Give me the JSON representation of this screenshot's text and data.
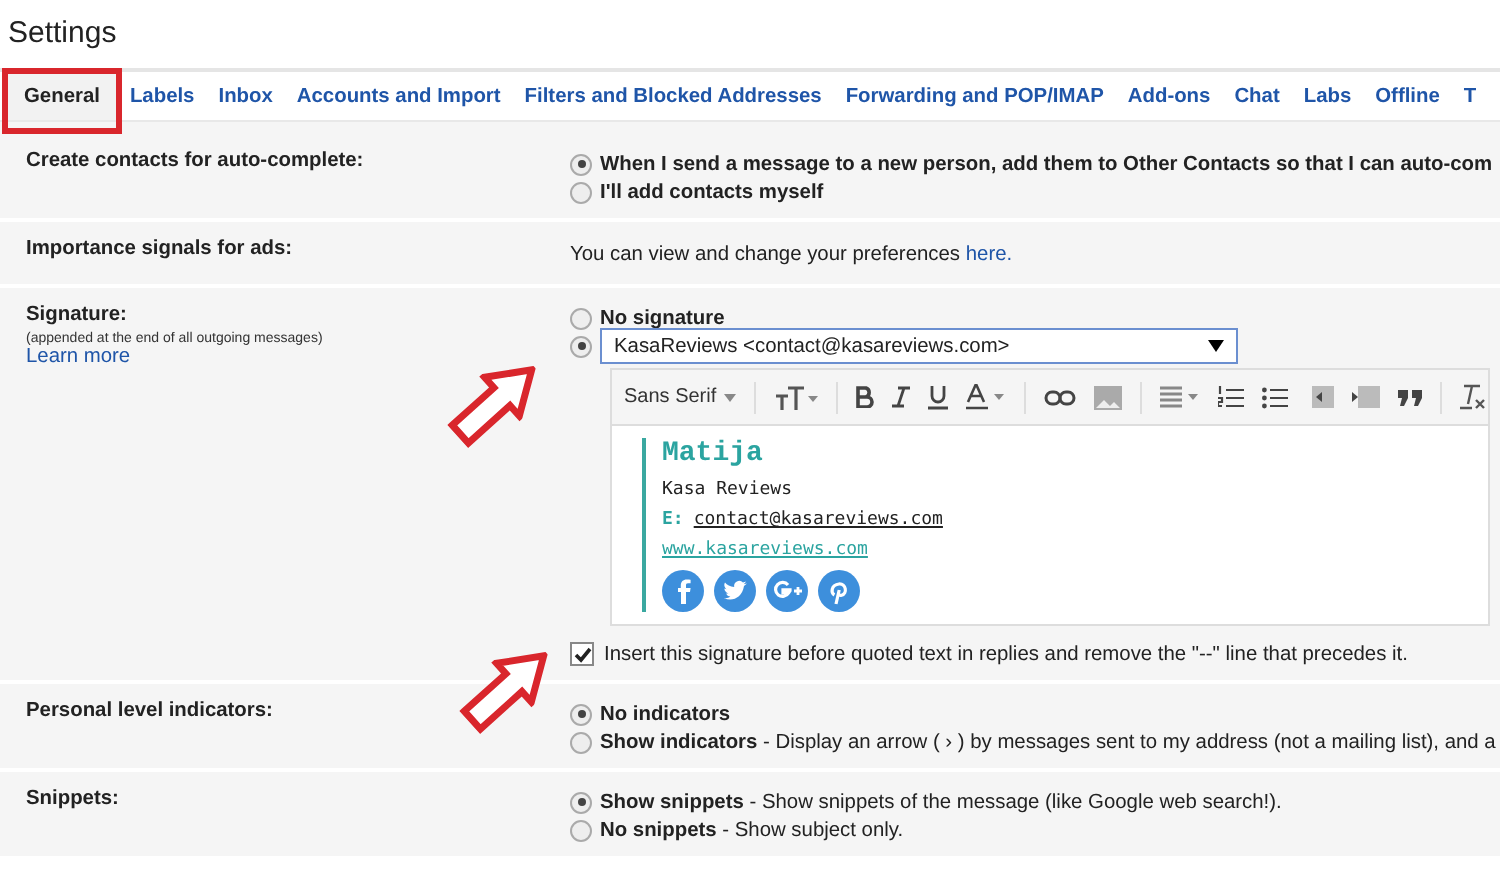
{
  "page_title": "Settings",
  "tabs": [
    {
      "label": "General",
      "selected": true
    },
    {
      "label": "Labels",
      "selected": false
    },
    {
      "label": "Inbox",
      "selected": false
    },
    {
      "label": "Accounts and Import",
      "selected": false
    },
    {
      "label": "Filters and Blocked Addresses",
      "selected": false
    },
    {
      "label": "Forwarding and POP/IMAP",
      "selected": false
    },
    {
      "label": "Add-ons",
      "selected": false
    },
    {
      "label": "Chat",
      "selected": false
    },
    {
      "label": "Labs",
      "selected": false
    },
    {
      "label": "Offline",
      "selected": false
    },
    {
      "label": "T",
      "selected": false
    }
  ],
  "settings": [
    {
      "kind": "radio",
      "label": "Create contacts for auto-complete:",
      "options": [
        {
          "text": "When I send a message to a new person, add them to Other Contacts so that I can auto-com",
          "bold": true,
          "selected": true
        },
        {
          "text": "I'll add contacts myself",
          "bold": true,
          "selected": false
        }
      ]
    },
    {
      "kind": "info",
      "label": "Importance signals for ads:",
      "text": "You can view and change your preferences",
      "link": "here."
    },
    {
      "kind": "signature",
      "label": "Signature:",
      "note": "(appended at the end of all outgoing messages)",
      "link": "Learn more",
      "none_option": {
        "text": "No signature",
        "selected": false
      },
      "custom_option": {
        "selected": true,
        "value": "KasaReviews <contact@kasareviews.com>"
      },
      "editor": {
        "font": "Sans Serif",
        "name": "Matija",
        "company": "Kasa Reviews",
        "email_label": "E:",
        "email": "contact@kasareviews.com",
        "website": "www.kasareviews.com"
      },
      "insert_before_quoted": {
        "checked": true,
        "text": "Insert this signature before quoted text in replies and remove the \"--\" line that precedes it."
      }
    },
    {
      "kind": "radio",
      "label": "Personal level indicators:",
      "options": [
        {
          "text": "No indicators",
          "bold": true,
          "selected": true
        },
        {
          "text": "**Show indicators** - Display an arrow ( › ) by messages sent to my address (not a mailing list), and a",
          "bold": false,
          "selected": false
        }
      ]
    },
    {
      "kind": "radio",
      "label": "Snippets:",
      "options": [
        {
          "text": "**Show snippets** - Show snippets of the message (like Google web search!).",
          "bold": false,
          "selected": true
        },
        {
          "text": "**No snippets** - Show subject only.",
          "bold": false,
          "selected": false
        }
      ]
    }
  ]
}
